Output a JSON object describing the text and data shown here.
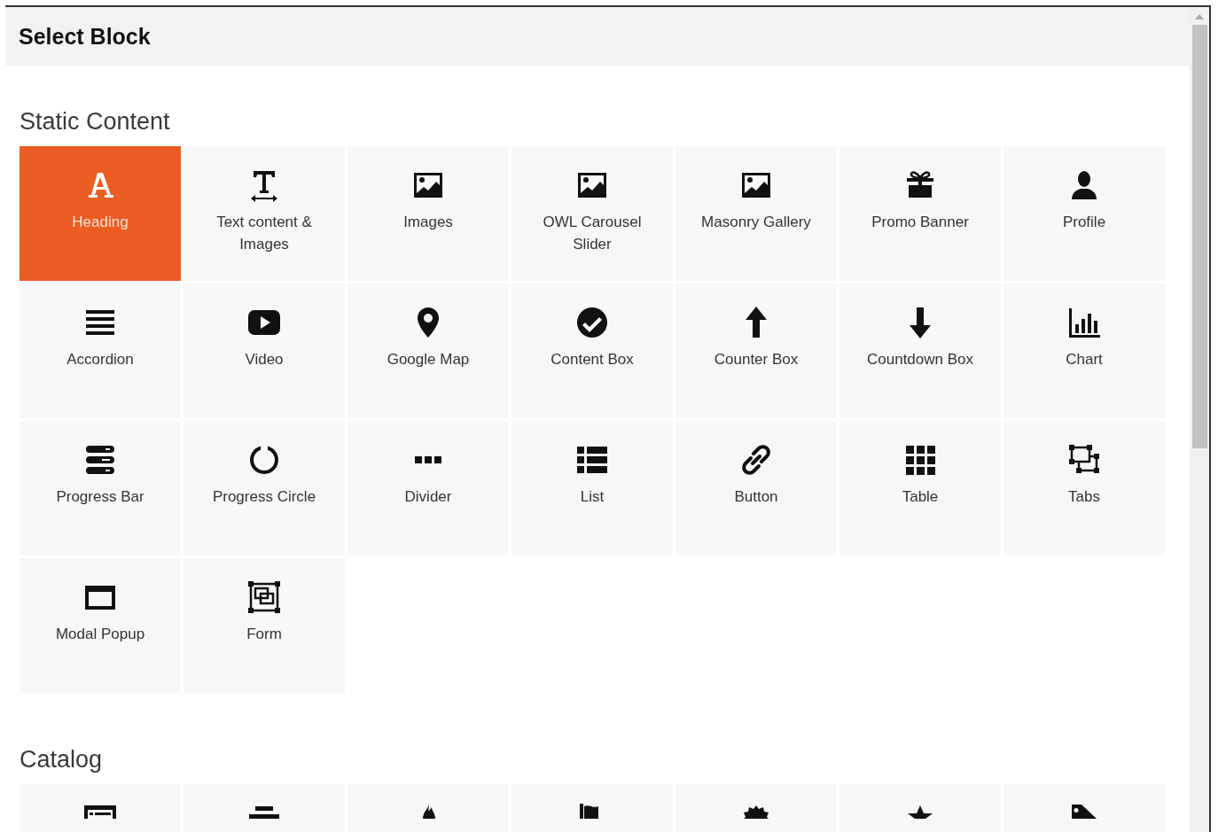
{
  "dialog": {
    "title": "Select Block"
  },
  "sections": [
    {
      "title": "Static Content",
      "blocks": [
        {
          "label": "Heading",
          "selected": true
        },
        {
          "label": "Text content & Images",
          "selected": false
        },
        {
          "label": "Images",
          "selected": false
        },
        {
          "label": "OWL Carousel Slider",
          "selected": false
        },
        {
          "label": "Masonry Gallery",
          "selected": false
        },
        {
          "label": "Promo Banner",
          "selected": false
        },
        {
          "label": "Profile",
          "selected": false
        },
        {
          "label": "Accordion",
          "selected": false
        },
        {
          "label": "Video",
          "selected": false
        },
        {
          "label": "Google Map",
          "selected": false
        },
        {
          "label": "Content Box",
          "selected": false
        },
        {
          "label": "Counter Box",
          "selected": false
        },
        {
          "label": "Countdown Box",
          "selected": false
        },
        {
          "label": "Chart",
          "selected": false
        },
        {
          "label": "Progress Bar",
          "selected": false
        },
        {
          "label": "Progress Circle",
          "selected": false
        },
        {
          "label": "Divider",
          "selected": false
        },
        {
          "label": "List",
          "selected": false
        },
        {
          "label": "Button",
          "selected": false
        },
        {
          "label": "Table",
          "selected": false
        },
        {
          "label": "Tabs",
          "selected": false
        },
        {
          "label": "Modal Popup",
          "selected": false
        },
        {
          "label": "Form",
          "selected": false
        }
      ]
    },
    {
      "title": "Catalog",
      "blocks": [
        {
          "selected": false
        },
        {
          "selected": false
        },
        {
          "selected": false
        },
        {
          "selected": false
        },
        {
          "selected": false
        },
        {
          "selected": false
        },
        {
          "selected": false
        }
      ]
    }
  ]
}
